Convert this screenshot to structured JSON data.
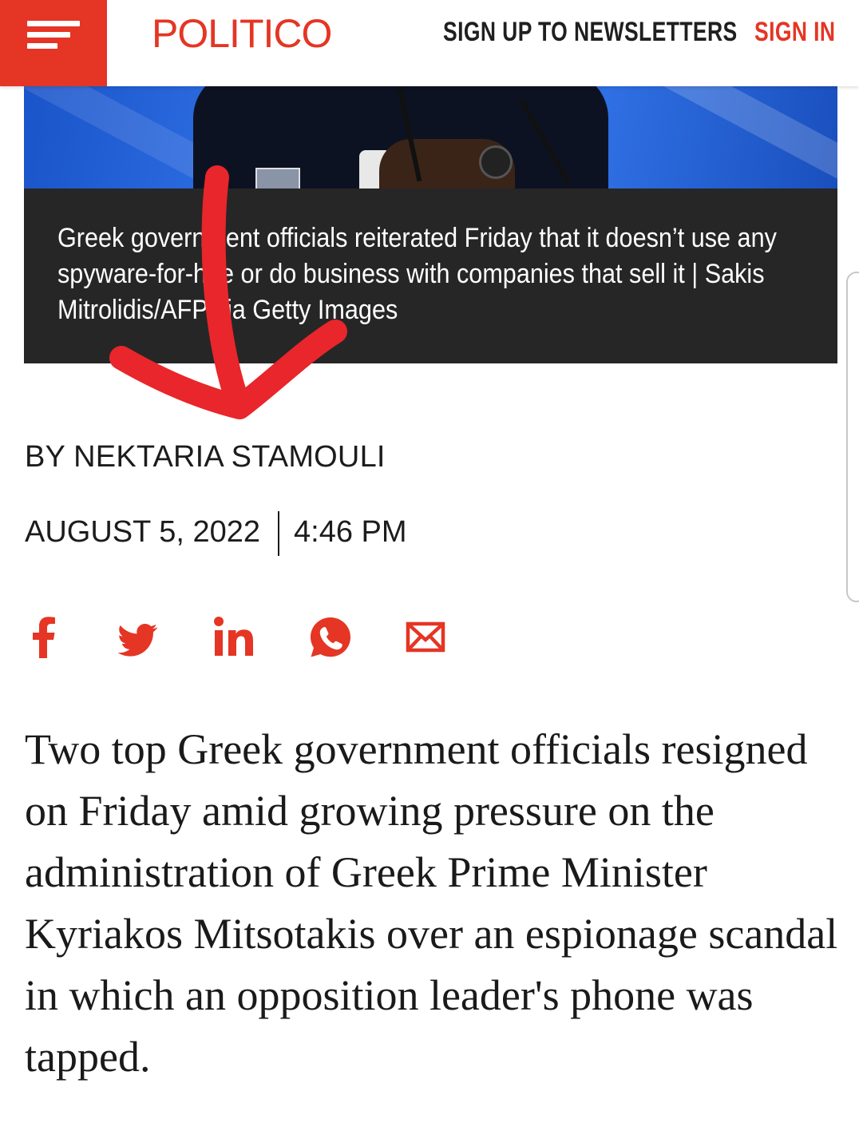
{
  "header": {
    "logo": "POLITICO",
    "newsletter_link": "SIGN UP TO NEWSLETTERS",
    "signin_link": "SIGN IN",
    "menu_icon": "hamburger-menu-icon",
    "accent_color": "#e53524"
  },
  "article": {
    "caption": "Greek government officials reiterated Friday that it doesn’t use any spyware-for-hire or do business with companies that sell it | Sakis Mitrolidis/AFP via Getty Images",
    "byline": "BY NEKTARIA STAMOULI",
    "date": "AUGUST 5, 2022",
    "time": "4:46 PM",
    "body": "Two top Greek government officials resigned on Friday amid growing pressure on the administration of Greek Prime Minister Kyriakos Mitsotakis over an espionage scandal in which an opposition leader's phone was tapped."
  },
  "share": {
    "icons": [
      "facebook-icon",
      "twitter-icon",
      "linkedin-icon",
      "whatsapp-icon",
      "email-icon"
    ]
  },
  "annotation": {
    "arrow_color": "#e8262b"
  }
}
